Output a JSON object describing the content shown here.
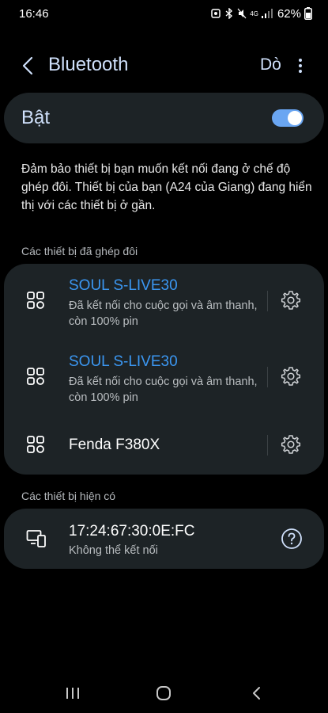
{
  "status_bar": {
    "time": "16:46",
    "network": "4G",
    "battery": "62%"
  },
  "header": {
    "title": "Bluetooth",
    "scan_label": "Dò"
  },
  "toggle": {
    "label": "Bật",
    "state": "on",
    "accent": "#6aa6f2"
  },
  "description": "Đảm bảo thiết bị bạn muốn kết nối đang ở chế độ ghép đôi. Thiết bị của bạn (A24 của Giang) đang hiển thị với các thiết bị ở gần.",
  "paired_section": {
    "title": "Các thiết bị đã ghép đôi",
    "devices": [
      {
        "name": "SOUL S-LIVE30",
        "status": "Đã kết nối cho cuộc gọi và âm thanh, còn 100% pin",
        "connected": true,
        "icon": "grid-device-icon"
      },
      {
        "name": "SOUL S-LIVE30",
        "status": "Đã kết nối cho cuộc gọi và âm thanh, còn 100% pin",
        "connected": true,
        "icon": "grid-device-icon"
      },
      {
        "name": "Fenda F380X",
        "status": "",
        "connected": false,
        "icon": "grid-device-icon"
      }
    ]
  },
  "available_section": {
    "title": "Các thiết bị hiện có",
    "devices": [
      {
        "name": "17:24:67:30:0E:FC",
        "status": "Không thể kết nối",
        "icon": "phone-monitor-icon"
      }
    ]
  },
  "colors": {
    "background": "#000000",
    "card": "#1d2326",
    "connected_text": "#3b97f2",
    "header_text": "#cfe0fb"
  }
}
